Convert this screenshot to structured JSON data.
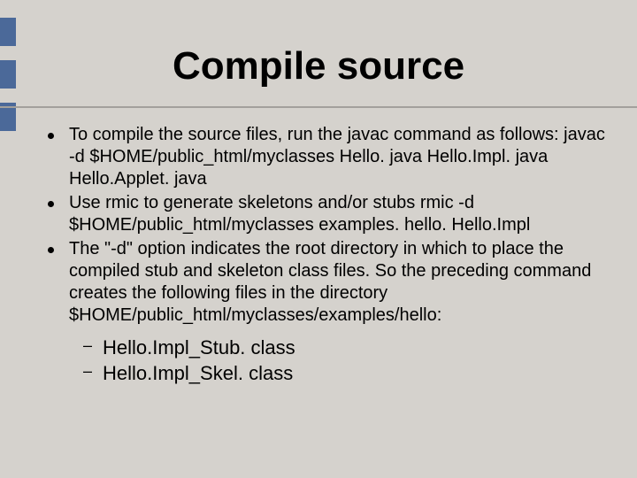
{
  "title": "Compile source",
  "bullets": [
    "To compile the source files, run the javac command as follows: javac  -d  $HOME/public_html/myclasses Hello. java  Hello.Impl. java  Hello.Applet. java",
    "Use rmic to generate skeletons and/or stubs rmic  -d $HOME/public_html/myclasses  examples. hello. Hello.Impl",
    "The \"-d\" option indicates the root directory in which to place the compiled stub and skeleton class files. So the preceding command creates the following files in the directory $HOME/public_html/myclasses/examples/hello:"
  ],
  "subbullets": [
    "Hello.Impl_Stub. class",
    "Hello.Impl_Skel. class"
  ],
  "markers": [
    20,
    68,
    116
  ]
}
